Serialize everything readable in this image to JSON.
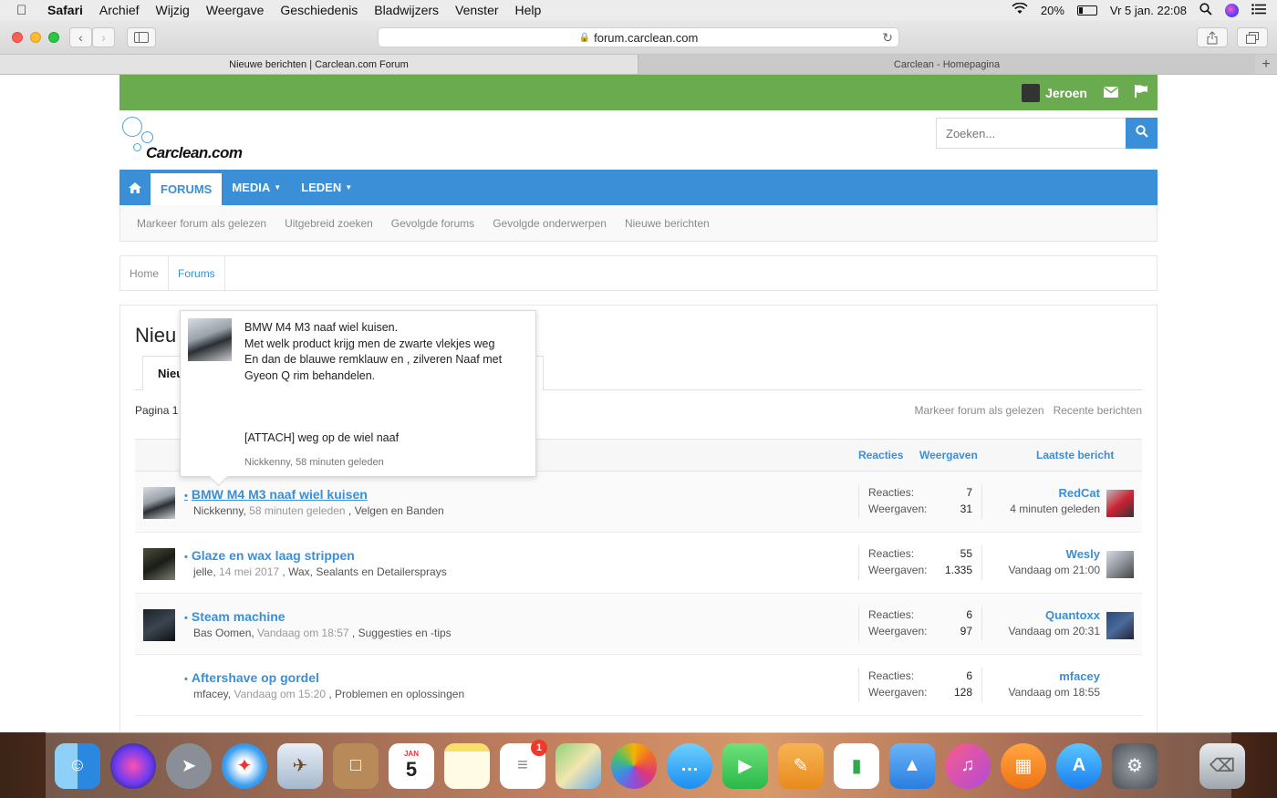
{
  "menubar": {
    "app": "Safari",
    "items": [
      "Archief",
      "Wijzig",
      "Weergave",
      "Geschiedenis",
      "Bladwijzers",
      "Venster",
      "Help"
    ],
    "battery": "20%",
    "datetime": "Vr 5 jan.  22:08"
  },
  "browser": {
    "url": "forum.carclean.com",
    "tabs": [
      {
        "title": "Nieuwe berichten | Carclean.com Forum",
        "active": true
      },
      {
        "title": "Carclean - Homepagina",
        "active": false
      }
    ]
  },
  "site": {
    "user": "Jeroen",
    "logo_text": "Carclean.com",
    "search_placeholder": "Zoeken...",
    "nav": [
      {
        "label": "FORUMS",
        "active": true,
        "dropdown": false
      },
      {
        "label": "MEDIA",
        "active": false,
        "dropdown": true
      },
      {
        "label": "LEDEN",
        "active": false,
        "dropdown": true
      }
    ],
    "subnav": [
      "Markeer forum als gelezen",
      "Uitgebreid zoeken",
      "Gevolgde forums",
      "Gevolgde onderwerpen",
      "Nieuwe berichten"
    ],
    "breadcrumb": [
      "Home",
      "Forums"
    ],
    "colors": {
      "userbar": "#6aab4f",
      "nav": "#3a8fd6",
      "link": "#3a8fd6"
    }
  },
  "main": {
    "page_title": "Nieu",
    "tab_label": "Nieu",
    "pager": "Pagina 1",
    "links": [
      "Markeer forum als gelezen",
      "Recente berichten"
    ],
    "headers": {
      "reactions": "Reacties",
      "views": "Weergaven",
      "last": "Laatste bericht"
    },
    "stat_labels": {
      "reactions": "Reacties:",
      "views": "Weergaven:"
    },
    "threads": [
      {
        "title": "BMW M4 M3 naaf wiel kuisen",
        "author": "Nickkenny",
        "time": "58 minuten geleden",
        "forum": "Velgen en Banden",
        "reactions": "7",
        "views": "31",
        "last_user": "RedCat",
        "last_time": "4 minuten geleden",
        "hovered": true
      },
      {
        "title": "Glaze en wax laag strippen",
        "author": "jelle",
        "time": "14 mei 2017",
        "forum": "Wax, Sealants en Detailersprays",
        "reactions": "55",
        "views": "1.335",
        "last_user": "Wesly",
        "last_time": "Vandaag om 21:00",
        "hovered": false
      },
      {
        "title": "Steam machine",
        "author": "Bas Oomen",
        "time": "Vandaag om 18:57",
        "forum": "Suggesties en -tips",
        "reactions": "6",
        "views": "97",
        "last_user": "Quantoxx",
        "last_time": "Vandaag om 20:31",
        "hovered": false
      },
      {
        "title": "Aftershave op gordel",
        "author": "mfacey",
        "time": "Vandaag om 15:20",
        "forum": "Problemen en oplossingen",
        "reactions": "6",
        "views": "128",
        "last_user": "mfacey",
        "last_time": "Vandaag om 18:55",
        "hovered": false
      }
    ]
  },
  "tooltip": {
    "lines": [
      "BMW M4 M3 naaf wiel kuisen.",
      "Met welk product krijg men de zwarte vlekjes weg",
      "En dan de blauwe remklauw en , zilveren Naaf met",
      "Gyeon Q rim behandelen."
    ],
    "attachment": "[ATTACH] weg op de wiel naaf",
    "author": "Nickkenny",
    "time": "58 minuten geleden"
  },
  "dock": {
    "icons": [
      "finder-icon",
      "siri-icon",
      "launchpad-icon",
      "safari-icon",
      "mail-icon",
      "notes-contacts-icon",
      "calendar-icon",
      "notes-icon",
      "reminders-icon",
      "maps-icon",
      "photos-icon",
      "messages-icon",
      "facetime-icon",
      "pages-icon",
      "numbers-icon",
      "keynote-icon",
      "itunes-icon",
      "ibooks-icon",
      "appstore-icon",
      "system-preferences-icon",
      "trash-icon"
    ],
    "calendar_month": "JAN",
    "calendar_day": "5",
    "reminders_badge": "1"
  }
}
